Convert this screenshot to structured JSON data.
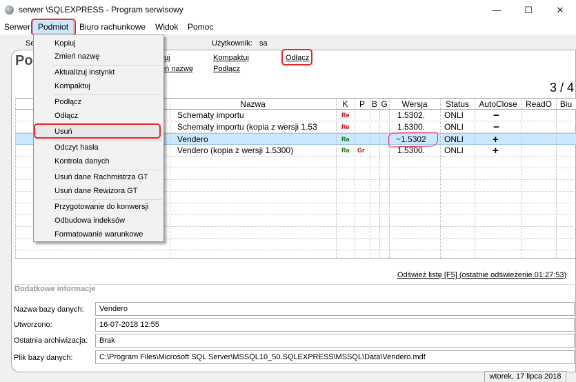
{
  "window": {
    "title": "serwer          \\SQLEXPRESS - Program serwisowy",
    "buttons": {
      "minimize": "—",
      "maximize": "☐",
      "close": "✕"
    }
  },
  "menubar": {
    "items": [
      "Serwer",
      "Podmiot",
      "Biuro rachunkowe",
      "Widok",
      "Pomoc"
    ]
  },
  "dropdown": {
    "items": [
      "Kopiuj",
      "Zmień nazwę",
      "Aktualizuj instynkt",
      "Kompaktuj",
      "Podłącz",
      "Odłącz",
      "Usuń",
      "Odczyt hasła",
      "Kontrola danych",
      "Usuń dane Rachmistrza GT",
      "Usuń dane Rewizora GT",
      "Przygotowanie do konwersji",
      "Odbudowa indeksów",
      "Formatowanie warunkowe"
    ]
  },
  "toolbar": {
    "tab_partial": "Se",
    "user_label": "Użytkownik:",
    "user_value": "sa",
    "link_a1": "uj",
    "link_a2": "eń nazwę",
    "link_compact": "Kompaktuj",
    "link_connect": "Podłącz",
    "link_disconnect": "Odłącz"
  },
  "main": {
    "title_partial": "Po",
    "counter": "3 / 4"
  },
  "grid": {
    "headers": [
      "Nazwa",
      "K",
      "P",
      "B",
      "G",
      "Wersja",
      "Status",
      "AutoClose",
      "ReadO",
      "Biu"
    ],
    "rows": [
      {
        "name": "Schematy importu",
        "k": "Re",
        "p": "",
        "version": "1.5302.",
        "status": "ONLI",
        "autoclose": "−"
      },
      {
        "name": "Schematy importu (kopia z wersji 1.53",
        "k": "Re",
        "p": "",
        "version": "1.5300.",
        "status": "ONLI",
        "autoclose": "−"
      },
      {
        "name": "Vendero",
        "k": "Ra",
        "p": "",
        "version": "~1.5302",
        "status": "ONLI",
        "autoclose": "+"
      },
      {
        "name": "Vendero (kopia z wersji 1.5300)",
        "k": "Ra",
        "p": "Gr",
        "version": "1.5300.",
        "status": "ONLI",
        "autoclose": "+"
      }
    ],
    "refresh_link": "Odśwież listę [F5] (ostatnie odświeżenie 01:27:53)"
  },
  "details": {
    "section_title": "Dodatkowe informacje",
    "fields": [
      {
        "label": "Nazwa bazy danych:",
        "value": "Vendero"
      },
      {
        "label": "Utworzono:",
        "value": "16-07-2018 12:55"
      },
      {
        "label": "Ostatnia archiwizacja:",
        "value": "Brak"
      },
      {
        "label": "Plik bazy danych:",
        "value": "C:\\Program Files\\Microsoft SQL Server\\MSSQL10_50.SQLEXPRESS\\MSSQL\\Data\\Vendero.mdf"
      }
    ]
  },
  "statusbar": {
    "date": "wtorek, 17 lipca 2018"
  },
  "colors": {
    "highlight_red": "#e8272b",
    "selected_row": "#cce8ff",
    "menu_hover": "#cce8ff"
  }
}
